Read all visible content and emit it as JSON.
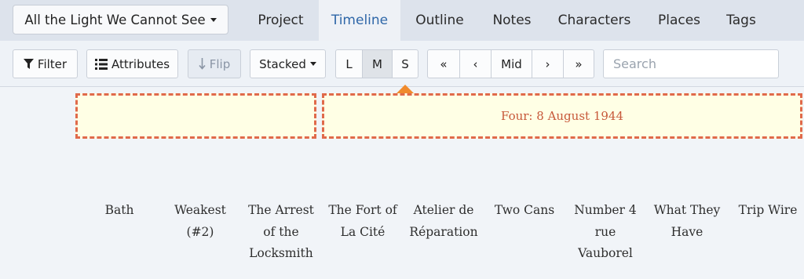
{
  "header": {
    "book_title": "All the Light We Cannot See",
    "tabs": [
      {
        "label": "Project"
      },
      {
        "label": "Timeline"
      },
      {
        "label": "Outline"
      },
      {
        "label": "Notes"
      },
      {
        "label": "Characters"
      },
      {
        "label": "Places"
      },
      {
        "label": "Tags"
      }
    ],
    "active_tab": "Timeline"
  },
  "toolbar": {
    "filter_label": "Filter",
    "attributes_label": "Attributes",
    "flip_label": "Flip",
    "layout_label": "Stacked",
    "size_options": [
      {
        "label": "L"
      },
      {
        "label": "M"
      },
      {
        "label": "S"
      }
    ],
    "size_selected": "M",
    "nav": [
      {
        "label": "«"
      },
      {
        "label": "‹"
      },
      {
        "label": "Mid"
      },
      {
        "label": "›"
      },
      {
        "label": "»"
      }
    ],
    "search_placeholder": "Search"
  },
  "timeline": {
    "chapters": [
      {
        "title": ""
      },
      {
        "title": "Four: 8 August 1944"
      }
    ],
    "scenes": [
      {
        "title": "Bath"
      },
      {
        "title": "Weakest (#2)"
      },
      {
        "title": "The Arrest of the Locksmith"
      },
      {
        "title": "The Fort of La Cité"
      },
      {
        "title": "Atelier de Réparation"
      },
      {
        "title": "Two Cans"
      },
      {
        "title": "Number 4 rue Vauborel"
      },
      {
        "title": "What They Have"
      },
      {
        "title": "Trip Wire"
      }
    ]
  },
  "colors": {
    "accent": "#2f67a8",
    "chapter_border": "#e06a4a",
    "chapter_fill": "#ffffe5",
    "pointer": "#f08a2c"
  }
}
